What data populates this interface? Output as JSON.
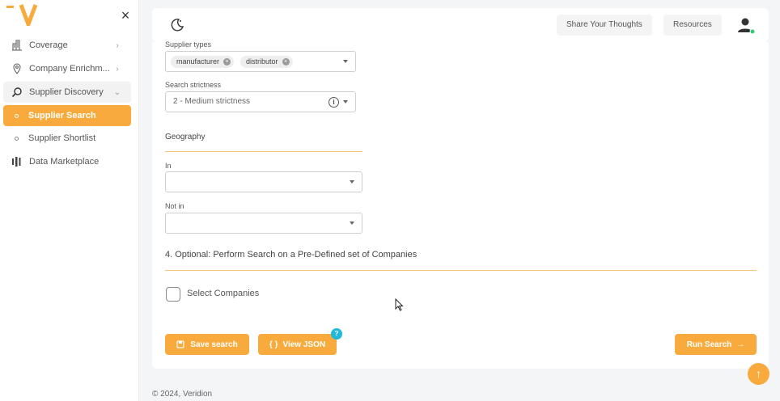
{
  "sidebar": {
    "close_symbol": "×",
    "items": [
      {
        "label": "Coverage",
        "icon": "building-icon",
        "chevron": "›"
      },
      {
        "label": "Company Enrichm...",
        "icon": "location-pin-icon",
        "chevron": "›"
      },
      {
        "label": "Supplier Discovery",
        "icon": "search-icon",
        "chevron": "⌄"
      },
      {
        "label": "Supplier Search",
        "icon": "dot-icon"
      },
      {
        "label": "Supplier Shortlist",
        "icon": "dot-icon"
      },
      {
        "label": "Data Marketplace",
        "icon": "bars-icon"
      }
    ]
  },
  "header": {
    "feedback_button": "Share Your Thoughts",
    "resources_button": "Resources",
    "user_status_color": "#2ecc71"
  },
  "form": {
    "supplier_types_label": "Supplier types",
    "supplier_types": [
      "manufacturer",
      "distributor"
    ],
    "chip_remove_symbol": "×",
    "strictness_label": "Search strictness",
    "strictness_value": "2 - Medium strictness",
    "info_symbol": "i",
    "geography_title": "Geography",
    "in_label": "In",
    "not_in_label": "Not in",
    "optional_section_title": "4. Optional: Perform Search on a Pre-Defined set of Companies",
    "select_companies_label": "Select Companies"
  },
  "actions": {
    "save_search": "Save search",
    "view_json": "View JSON",
    "view_json_icon": "{ }",
    "view_json_badge": "?",
    "run_search": "Run Search",
    "run_arrow": "→"
  },
  "footer": {
    "copyright": "© 2024, Veridion"
  },
  "scroll_top_symbol": "↑",
  "colors": {
    "accent": "#f8ab3c",
    "badge": "#22b8d9"
  }
}
